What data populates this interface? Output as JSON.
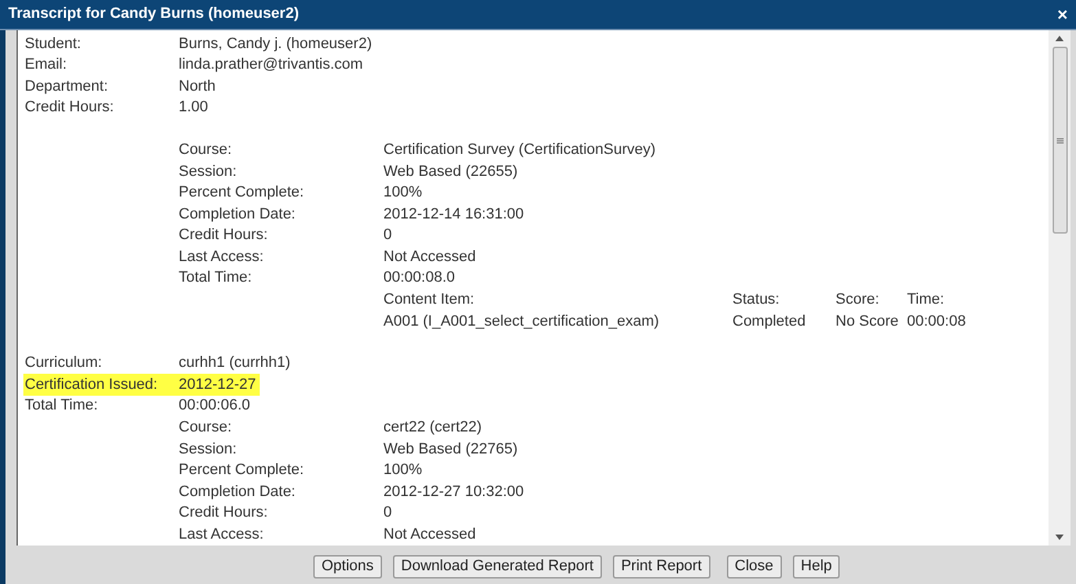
{
  "window": {
    "title": "Transcript for Candy Burns (homeuser2)",
    "close": "×"
  },
  "student": [
    {
      "label": "Student:",
      "value": "Burns, Candy j. (homeuser2)"
    },
    {
      "label": "Email:",
      "value": "linda.prather@trivantis.com"
    },
    {
      "label": "Department:",
      "value": "North"
    },
    {
      "label": "Credit Hours:",
      "value": "1.00"
    }
  ],
  "course_1": {
    "fields": [
      {
        "label": "Course:",
        "value": "Certification Survey (CertificationSurvey)"
      },
      {
        "label": "Session:",
        "value": "Web Based (22655)"
      },
      {
        "label": "Percent Complete:",
        "value": "100%"
      },
      {
        "label": "Completion Date:",
        "value": "2012-12-14 16:31:00"
      },
      {
        "label": "Credit Hours:",
        "value": "0"
      },
      {
        "label": "Last Access:",
        "value": "Not Accessed"
      },
      {
        "label": "Total Time:",
        "value": "00:00:08.0"
      }
    ],
    "content_items": {
      "columns": [
        "Content Item:",
        "Status:",
        "Score:",
        "Time:"
      ],
      "rows": [
        [
          "A001 (I_A001_select_certification_exam)",
          "Completed",
          "No Score",
          "00:00:08"
        ]
      ]
    }
  },
  "curriculum": [
    {
      "label": "Curriculum:",
      "value": "curhh1 (currhh1)",
      "highlighted": false
    },
    {
      "label": "Certification Issued:",
      "value": "2012-12-27",
      "highlighted": true
    },
    {
      "label": "Total Time:",
      "value": "00:00:06.0",
      "highlighted": false
    }
  ],
  "course_2": {
    "fields": [
      {
        "label": "Course:",
        "value": "cert22 (cert22)"
      },
      {
        "label": "Session:",
        "value": "Web Based (22765)"
      },
      {
        "label": "Percent Complete:",
        "value": "100%"
      },
      {
        "label": "Completion Date:",
        "value": "2012-12-27 10:32:00"
      },
      {
        "label": "Credit Hours:",
        "value": "0"
      },
      {
        "label": "Last Access:",
        "value": "Not Accessed"
      }
    ]
  },
  "buttons": [
    {
      "label": "Options",
      "kind": "normal"
    },
    {
      "label": "Download Generated Report",
      "kind": "normal"
    },
    {
      "label": "Print Report",
      "kind": "normal"
    },
    {
      "label": "Close",
      "kind": "spaced"
    },
    {
      "label": "Help",
      "kind": "normal"
    }
  ]
}
